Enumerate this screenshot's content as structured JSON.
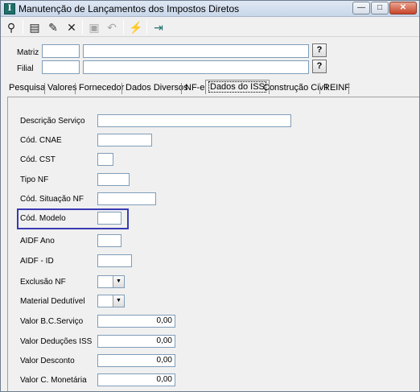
{
  "window": {
    "title": "Manutenção de Lançamentos dos Impostos Diretos",
    "app_icon_letter": "I",
    "minimize_glyph": "—",
    "maximize_glyph": "□",
    "close_glyph": "✕"
  },
  "toolbar": {
    "buttons": [
      {
        "name": "search",
        "glyph": "⚲"
      },
      {
        "name": "new-record",
        "glyph": "▤"
      },
      {
        "name": "edit",
        "glyph": "✎"
      },
      {
        "name": "delete",
        "glyph": "✕"
      },
      {
        "name": "save",
        "glyph": "▣"
      },
      {
        "name": "undo",
        "glyph": "↶"
      },
      {
        "name": "filter",
        "glyph": "⚡"
      },
      {
        "name": "exit",
        "glyph": "⇥"
      }
    ]
  },
  "header": {
    "matriz_label": "Matriz",
    "filial_label": "Filial",
    "matriz_code": "",
    "matriz_name": "",
    "filial_code": "",
    "filial_name": "",
    "lookup_label": "?"
  },
  "tabs": [
    {
      "label": "Pesquisa"
    },
    {
      "label": "Valores"
    },
    {
      "label": "Fornecedor"
    },
    {
      "label": "Dados Diversos"
    },
    {
      "label": "NF-e"
    },
    {
      "label": "Dados do ISS",
      "active": true
    },
    {
      "label": "Construção Civil"
    },
    {
      "label": "REINF"
    }
  ],
  "form": {
    "descricao_servico": {
      "label": "Descrição Serviço",
      "value": ""
    },
    "cod_cnae": {
      "label": "Cód. CNAE",
      "value": ""
    },
    "cod_cst": {
      "label": "Cód. CST",
      "value": ""
    },
    "tipo_nf": {
      "label": "Tipo NF",
      "value": ""
    },
    "cod_situacao_nf": {
      "label": "Cód. Situação NF",
      "value": ""
    },
    "cod_modelo": {
      "label": "Cód. Modelo",
      "value": ""
    },
    "aidf_ano": {
      "label": "AIDF Ano",
      "value": ""
    },
    "aidf_id": {
      "label": "AIDF - ID",
      "value": ""
    },
    "exclusao_nf": {
      "label": "Exclusão NF",
      "value": ""
    },
    "material_dedutivel": {
      "label": "Material Dedutível",
      "value": ""
    },
    "valor_bc_servico": {
      "label": "Valor B.C.Serviço",
      "value": "0,00"
    },
    "valor_deducoes_iss": {
      "label": "Valor Deduções ISS",
      "value": "0,00"
    },
    "valor_desconto": {
      "label": "Valor Desconto",
      "value": "0,00"
    },
    "valor_c_monetaria": {
      "label": "Valor C. Monetária",
      "value": "0,00"
    }
  },
  "colors": {
    "highlight": "#3a3ab6",
    "input_border": "#7f9db9"
  }
}
